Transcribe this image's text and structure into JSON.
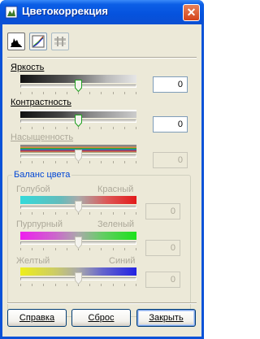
{
  "window": {
    "title": "Цветокоррекция",
    "close_glyph": "✕"
  },
  "toolbar": {
    "buttons": [
      {
        "name": "histogram-tool",
        "icon": "histogram-icon",
        "active": true
      },
      {
        "name": "color-curve-tool",
        "icon": "color-curve-icon",
        "active": false
      },
      {
        "name": "levels-tool",
        "icon": "levels-icon",
        "active": false,
        "disabled": true
      }
    ]
  },
  "brightness": {
    "label": "Яркость",
    "value": "0",
    "level": 0.5
  },
  "contrast": {
    "label": "Контрастность",
    "value": "0",
    "level": 0.5
  },
  "saturation": {
    "label": "Насыщенность",
    "value": "0",
    "level": 0.5
  },
  "color_balance": {
    "title": "Баланс цвета",
    "cyan_red": {
      "left": "Голубой",
      "right": "Красный",
      "value": "0",
      "level": 0.5
    },
    "magenta_green": {
      "left": "Пурпурный",
      "right": "Зеленый",
      "value": "0",
      "level": 0.5
    },
    "yellow_blue": {
      "left": "Желтый",
      "right": "Синий",
      "value": "0",
      "level": 0.5
    }
  },
  "buttons": {
    "help": "Справка",
    "reset": "Сброс",
    "close": "Закрыть"
  },
  "colors": {
    "title_bar": "#0552dd",
    "dialog_bg": "#ece9d8",
    "group_title": "#0046d5",
    "disabled_text": "#aca899"
  }
}
